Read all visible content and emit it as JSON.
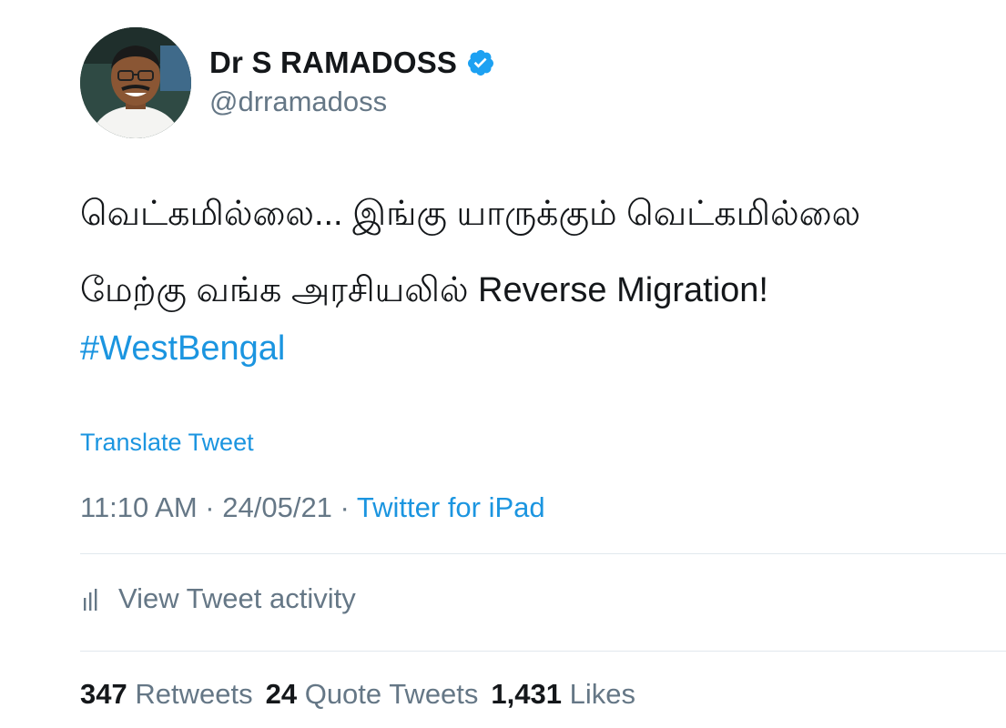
{
  "user": {
    "display_name": "Dr S RAMADOSS",
    "handle": "@drramadoss",
    "verified": true
  },
  "tweet": {
    "line1": "வெட்கமில்லை... இங்கு யாருக்கும் வெட்கமில்லை",
    "line2": "மேற்கு வங்க அரசியலில் Reverse Migration!",
    "hashtag": "#WestBengal"
  },
  "translate_label": "Translate Tweet",
  "meta": {
    "time": "11:10 AM",
    "separator": " · ",
    "date": "24/05/21",
    "source": "Twitter for iPad"
  },
  "activity_label": "View Tweet activity",
  "stats": {
    "retweets_count": "347",
    "retweets_label": "Retweets",
    "quotes_count": "24",
    "quotes_label": "Quote Tweets",
    "likes_count": "1,431",
    "likes_label": "Likes"
  },
  "colors": {
    "link": "#1b95e0",
    "secondary": "#657786",
    "verified_badge": "#1da1f2"
  },
  "icons": {
    "verified": "verified-badge-icon",
    "activity": "bar-chart-icon"
  }
}
